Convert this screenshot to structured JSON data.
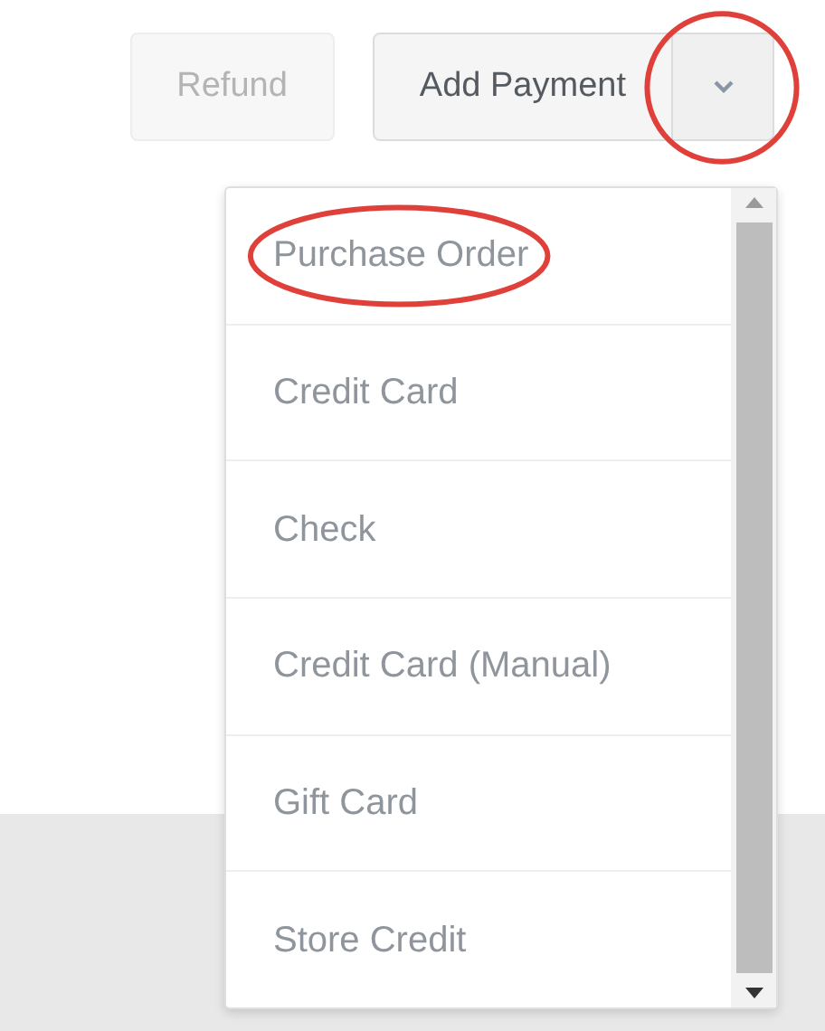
{
  "buttons": [
    {
      "label": "Refund",
      "disabled": true
    },
    {
      "label": "Add Payment",
      "disabled": false
    }
  ],
  "dropdown_toggle": {
    "expanded": true,
    "circled": true
  },
  "menu": {
    "items": [
      {
        "label": "Purchase Order",
        "circled": true
      },
      {
        "label": "Credit Card",
        "circled": false
      },
      {
        "label": "Check",
        "circled": false
      },
      {
        "label": "Credit Card (Manual)",
        "circled": false
      },
      {
        "label": "Gift Card",
        "circled": false
      },
      {
        "label": "Store Credit",
        "circled": false
      }
    ]
  }
}
